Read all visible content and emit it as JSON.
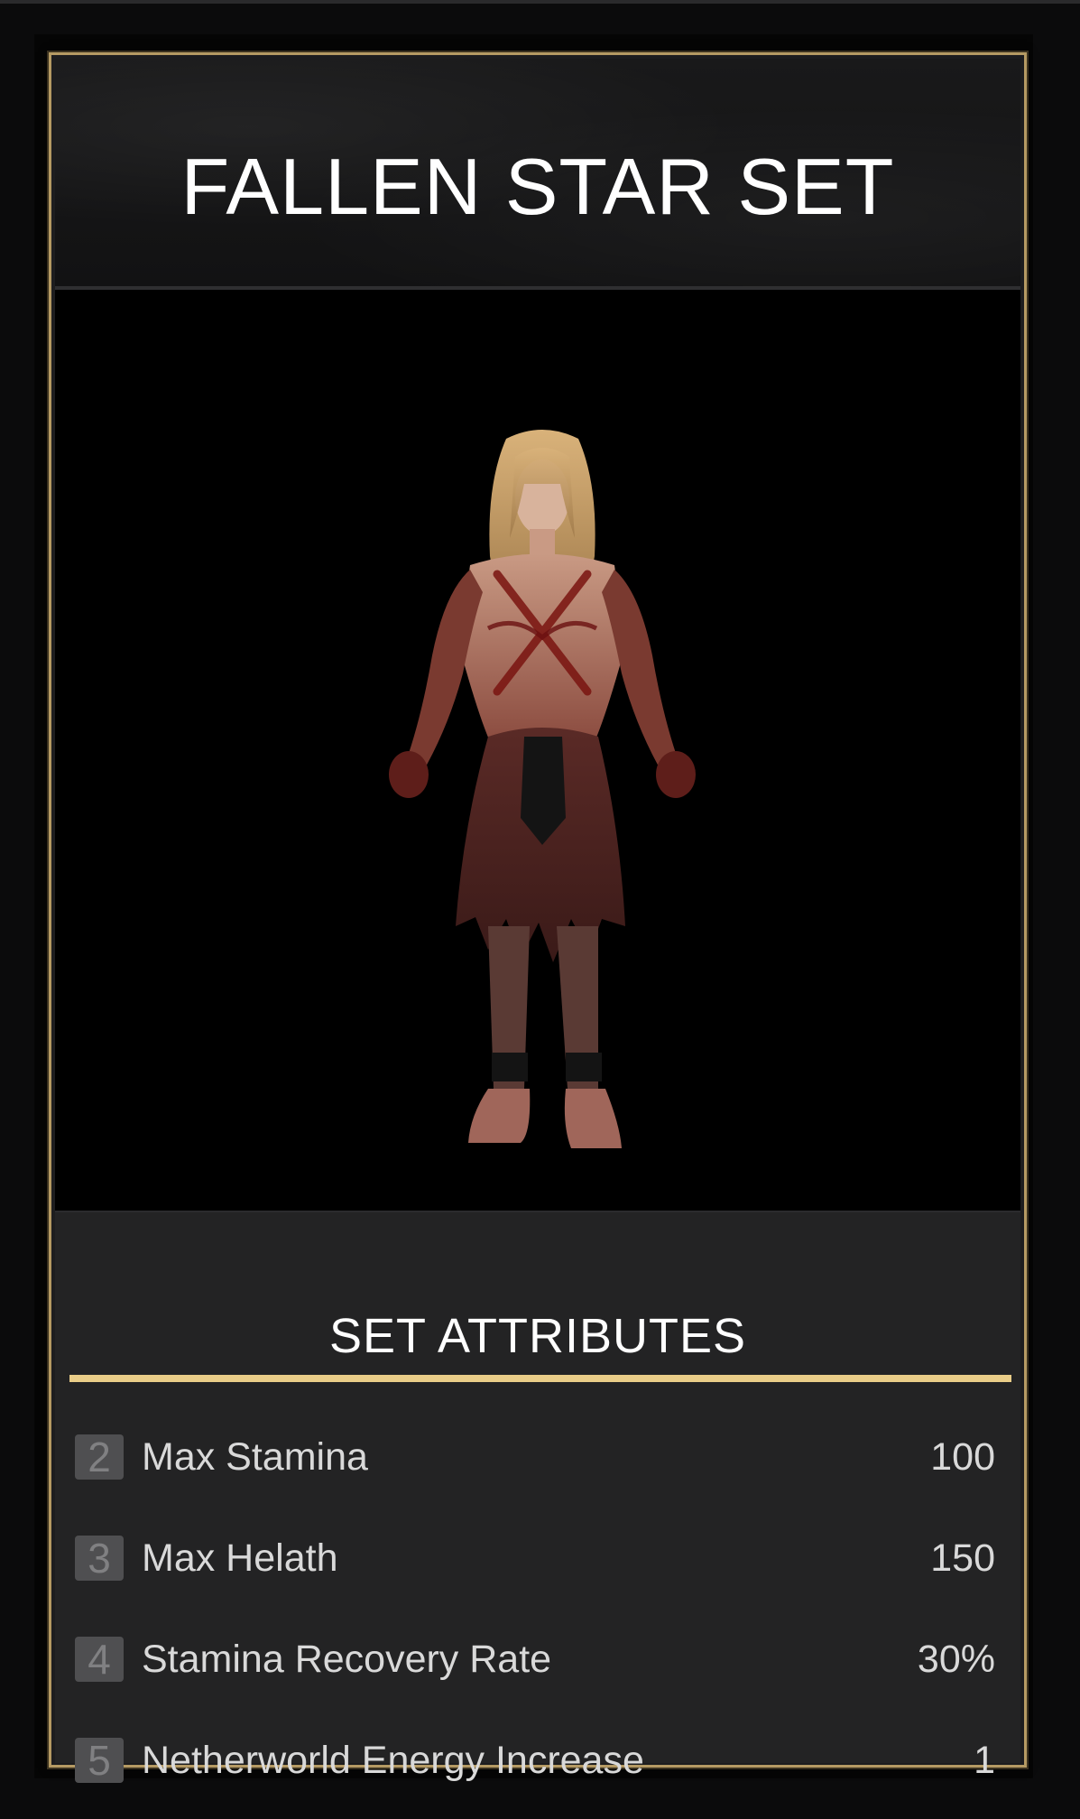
{
  "set": {
    "title": "FALLEN STAR SET",
    "image_alt": "Fallen Star Set character preview"
  },
  "attributes": {
    "heading": "SET ATTRIBUTES",
    "accent_color": "#e9cd88",
    "rows": [
      {
        "pieces": "2",
        "name": "Max Stamina",
        "value": "100"
      },
      {
        "pieces": "3",
        "name": "Max Helath",
        "value": "150"
      },
      {
        "pieces": "4",
        "name": "Stamina Recovery Rate",
        "value": "30%"
      },
      {
        "pieces": "5",
        "name": "Netherworld Energy Increase",
        "value": "1"
      }
    ]
  },
  "colors": {
    "frame_gold": "#b59a63",
    "panel_bg": "#232324",
    "image_bg": "#000000"
  }
}
